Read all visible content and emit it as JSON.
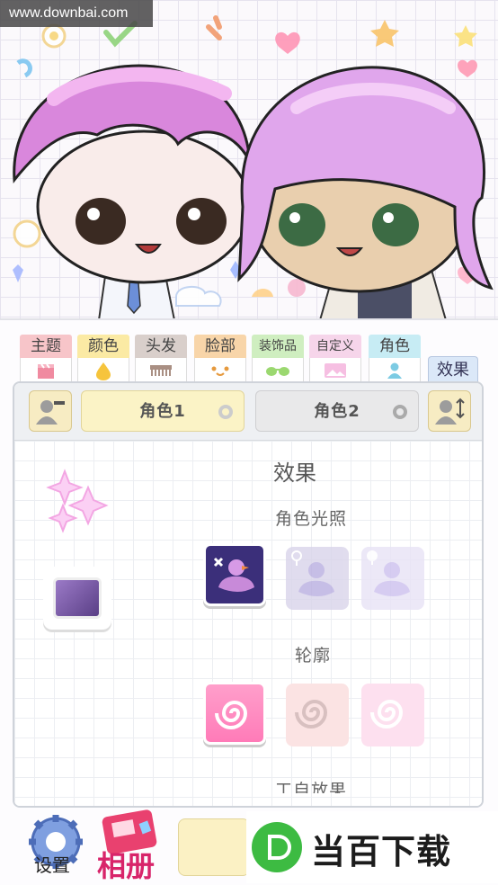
{
  "watermark": "www.downbai.com",
  "tabs": [
    {
      "label": "主题",
      "color": "#f7c5c9"
    },
    {
      "label": "颜色",
      "color": "#fbeaa4"
    },
    {
      "label": "头发",
      "color": "#d9cfcb"
    },
    {
      "label": "脸部",
      "color": "#f8d5a9"
    },
    {
      "label": "装饰品",
      "color": "#cfeec0"
    },
    {
      "label": "自定义",
      "color": "#f6d5ea"
    },
    {
      "label": "角色",
      "color": "#c7ecf4"
    }
  ],
  "active_tab": "效果",
  "character_buttons": {
    "char1": "角色1",
    "char2": "角色2"
  },
  "panel": {
    "title": "效果",
    "lighting_label": "角色光照",
    "outline_label": "轮廓",
    "next_label_partial": "工自放果"
  },
  "bottom": {
    "settings_label": "设置",
    "album_label": "相册",
    "ad_text": "当百下载"
  },
  "colors": {
    "accent_pink": "#d8246a",
    "ad_green": "#3dbb42"
  }
}
